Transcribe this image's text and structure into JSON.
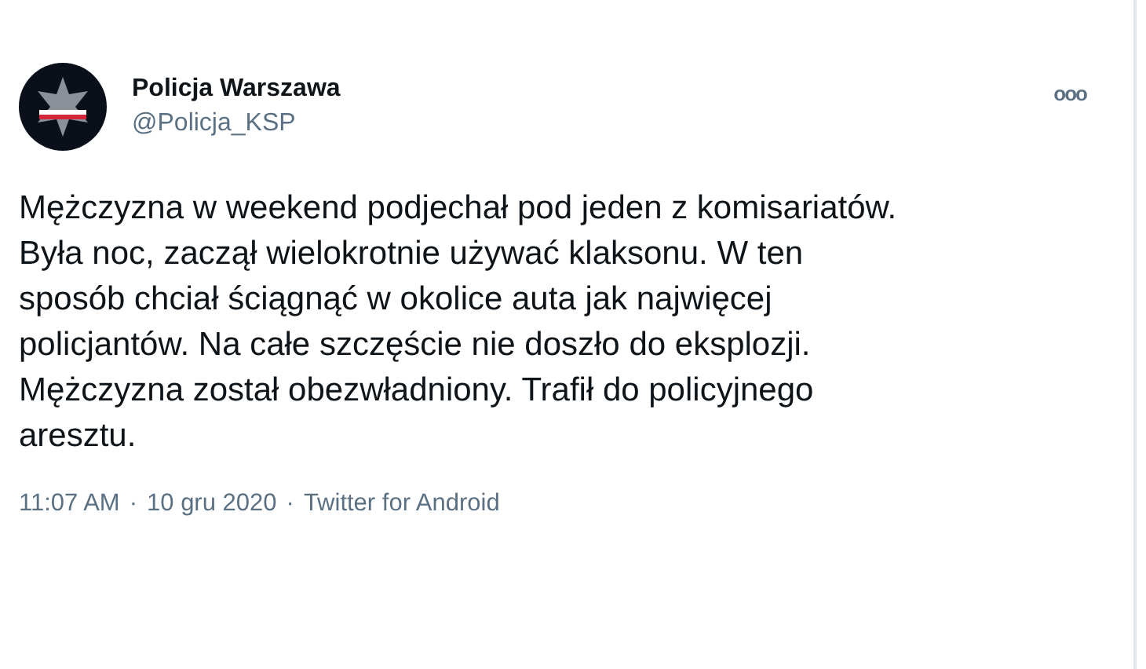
{
  "author": {
    "name": "Policja Warszawa",
    "handle": "@Policja_KSP"
  },
  "more_menu": "ooo",
  "tweet": {
    "text": "Mężczyzna w weekend podjechał pod jeden z komisariatów. Była noc, zaczął wielokrotnie używać klaksonu. W ten sposób chciał ściągnąć w okolice auta jak najwięcej policjantów. Na całe szczęście nie doszło do eksplozji. Mężczyzna został obezwładniony. Trafił do policyjnego aresztu."
  },
  "meta": {
    "time": "11:07 AM",
    "separator_1": "·",
    "date": "10 gru 2020",
    "separator_2": "·",
    "source": "Twitter for Android"
  }
}
